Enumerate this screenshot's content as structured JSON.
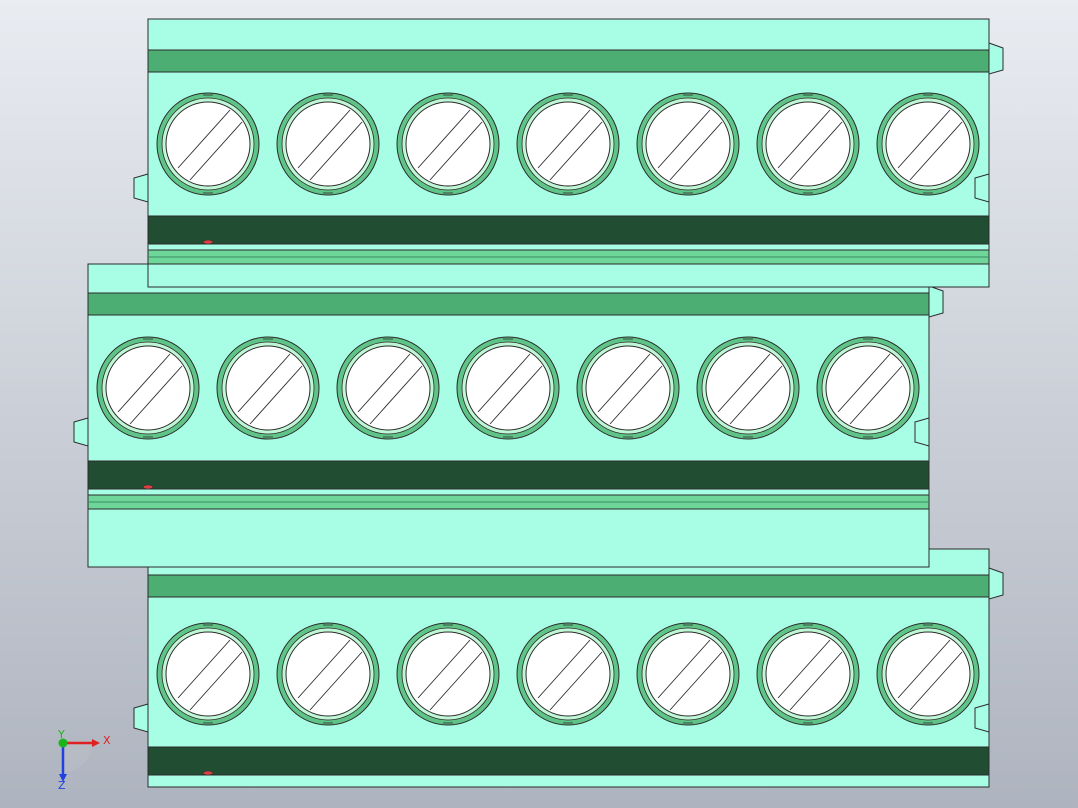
{
  "viewport": {
    "background_top": "#e9ecf1",
    "background_bottom": "#aeb4bf"
  },
  "model": {
    "body_color": "#a8fde5",
    "band_color": "#4dae74",
    "dark_band_color": "#214e32",
    "rail_color": "#6fd69a",
    "outline_color": "#2b2b2b",
    "screw_face_color": "#ffffff",
    "ring_color": "#5fc487",
    "terminal_blocks": [
      {
        "name": "top",
        "poles": 7
      },
      {
        "name": "middle",
        "poles": 7
      },
      {
        "name": "bottom",
        "poles": 7
      }
    ]
  },
  "triad": {
    "x_label": "X",
    "y_label": "Y",
    "z_label": "Z",
    "x_color": "#e02020",
    "y_color": "#19b519",
    "z_color": "#2040e0"
  }
}
